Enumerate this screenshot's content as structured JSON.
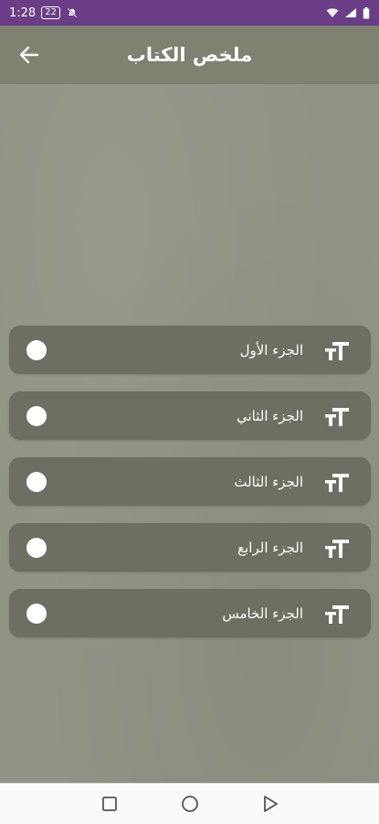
{
  "status_bar": {
    "time": "1:28",
    "badge": "22",
    "icons": [
      "mute-bell-icon",
      "wifi-icon",
      "signal-icon",
      "battery-icon"
    ]
  },
  "app_bar": {
    "title": "ملخص الكتاب",
    "back_icon": "arrow-back-icon"
  },
  "colors": {
    "status_bar": "#6a3d86",
    "app_bar": "#7f8171",
    "background": "#8f9485",
    "item_bg": "#6e6e62",
    "text": "#ffffff"
  },
  "items": [
    {
      "label": "الجزء الأول",
      "icon": "text-size-icon"
    },
    {
      "label": "الجزء الثاني",
      "icon": "text-size-icon"
    },
    {
      "label": "الجزء الثالث",
      "icon": "text-size-icon"
    },
    {
      "label": "الجزء الرابع",
      "icon": "text-size-icon"
    },
    {
      "label": "الجزء الخامس",
      "icon": "text-size-icon"
    }
  ],
  "nav_bar": [
    "recents-icon",
    "home-icon",
    "back-icon"
  ]
}
